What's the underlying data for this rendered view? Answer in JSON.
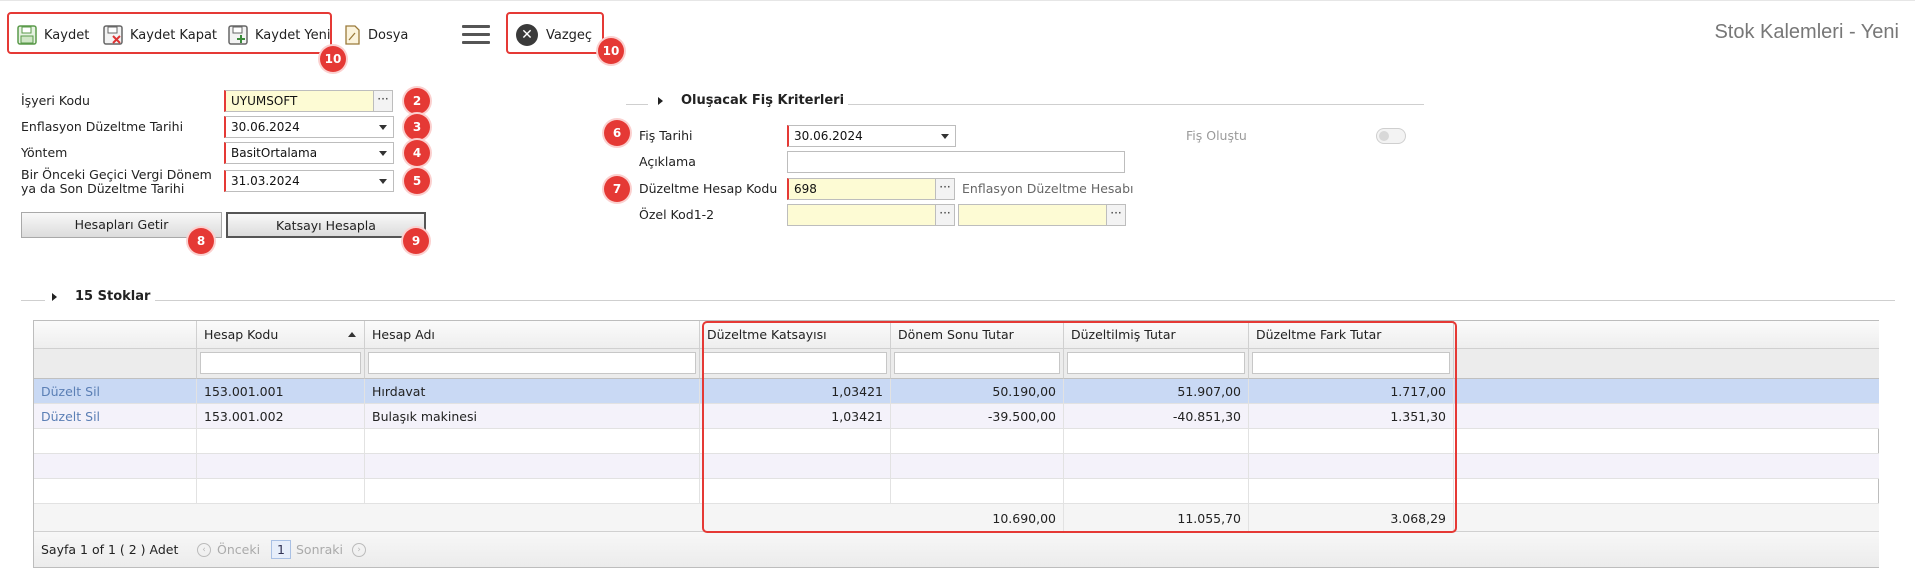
{
  "toolbar": {
    "save": "Kaydet",
    "save_close": "Kaydet Kapat",
    "save_new": "Kaydet Yeni",
    "file": "Dosya",
    "cancel": "Vazgeç",
    "page_title": "Stok Kalemleri - Yeni"
  },
  "badges": {
    "b1": "2",
    "b2": "3",
    "b3": "4",
    "b4": "5",
    "b5": "6",
    "b6": "7",
    "b7": "8",
    "b8": "9",
    "b9": "10",
    "b10": "10"
  },
  "form": {
    "workplace_label": "İşyeri Kodu",
    "workplace_value": "UYUMSOFT",
    "inflation_date_label": "Enflasyon Düzeltme Tarihi",
    "inflation_date_value": "30.06.2024",
    "method_label": "Yöntem",
    "method_value": "BasitOrtalama",
    "prev_period_label_1": "Bir Önceki Geçici Vergi Dönem",
    "prev_period_label_2": "ya da Son Düzeltme Tarihi",
    "prev_period_value": "31.03.2024",
    "get_accounts_button": "Hesapları Getir",
    "calc_coef_button": "Katsayı Hesapla"
  },
  "voucher": {
    "section_title": "Oluşacak Fiş Kriterleri",
    "date_label": "Fiş Tarihi",
    "date_value": "30.06.2024",
    "created_label": "Fiş Oluştu",
    "desc_label": "Açıklama",
    "desc_value": "",
    "account_label": "Düzeltme Hesap Kodu",
    "account_value": "698",
    "account_name": "Enflasyon Düzeltme Hesabı",
    "special_label": "Özel Kod1-2",
    "special1_value": "",
    "special2_value": ""
  },
  "stocks": {
    "section_title": "15 Stoklar",
    "columns": [
      "",
      "Hesap Kodu",
      "Hesap Adı",
      "Düzeltme Katsayısı",
      "Dönem Sonu Tutar",
      "Düzeltilmiş Tutar",
      "Düzeltme Fark Tutar"
    ],
    "rows": [
      {
        "action": "Düzelt Sil",
        "code": "153.001.001",
        "name": "Hırdavat",
        "coef": "1,03421",
        "period_end": "50.190,00",
        "adjusted": "51.907,00",
        "diff": "1.717,00"
      },
      {
        "action": "Düzelt Sil",
        "code": "153.001.002",
        "name": "Bulaşık makinesi",
        "coef": "1,03421",
        "period_end": "-39.500,00",
        "adjusted": "-40.851,30",
        "diff": "1.351,30"
      }
    ],
    "totals": {
      "period_end": "10.690,00",
      "adjusted": "11.055,70",
      "diff": "3.068,29"
    },
    "pager": {
      "info": "Sayfa 1 of 1 ( 2 ) Adet",
      "prev": "Önceki",
      "page": "1",
      "next": "Sonraki"
    }
  },
  "colors": {
    "accent_red": "#e53935",
    "required_yellow": "#fdfbd4",
    "selected_row": "#c9d9f4",
    "link_blue": "#5b7fb5"
  }
}
